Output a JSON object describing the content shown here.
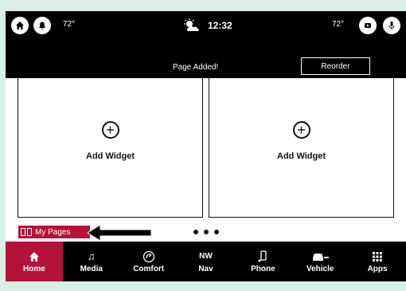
{
  "status": {
    "left_temp": "72°",
    "right_temp": "72°",
    "time": "12:32"
  },
  "notification": {
    "message": "Page Added!",
    "reorder_label": "Reorder"
  },
  "widgets": [
    {
      "label": "Add Widget"
    },
    {
      "label": "Add Widget"
    }
  ],
  "my_pages_label": "My Pages",
  "nav": [
    {
      "label": "Home",
      "icon": "home-icon",
      "active": true
    },
    {
      "label": "Media",
      "icon": "music-note-icon"
    },
    {
      "label": "Comfort",
      "icon": "comfort-icon"
    },
    {
      "label": "Nav",
      "icon": "compass-nw-icon",
      "icon_text": "NW"
    },
    {
      "label": "Phone",
      "icon": "phone-icon"
    },
    {
      "label": "Vehicle",
      "icon": "car-icon"
    },
    {
      "label": "Apps",
      "icon": "apps-grid-icon"
    }
  ],
  "colors": {
    "accent": "#b5123a",
    "background": "#000000"
  }
}
